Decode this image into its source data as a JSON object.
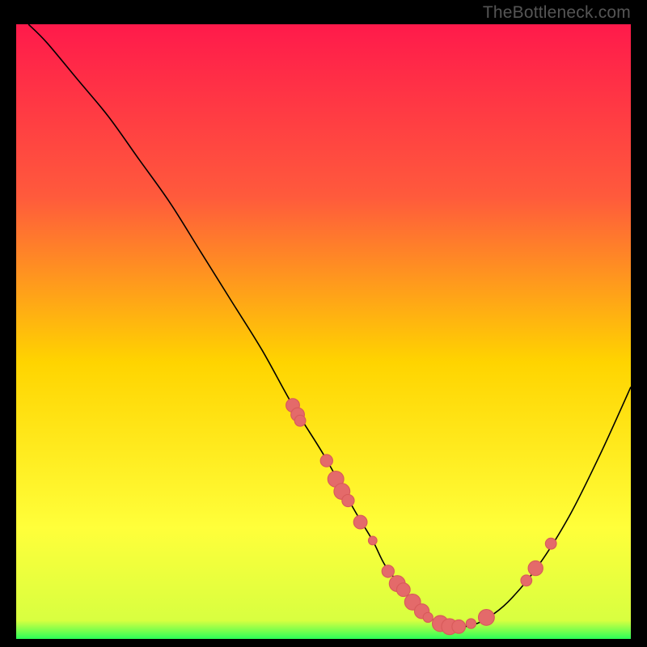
{
  "watermark": "TheBottleneck.com",
  "colors": {
    "background": "#000000",
    "gradient_top": "#ff1a4b",
    "gradient_upper": "#ff5a3c",
    "gradient_mid": "#ffd400",
    "gradient_lower": "#ffff3a",
    "gradient_bottom": "#2bff58",
    "curve": "#000000",
    "marker_fill": "#e46a6a",
    "marker_stroke": "#d85a5a"
  },
  "chart_data": {
    "type": "line",
    "title": "",
    "xlabel": "",
    "ylabel": "",
    "xlim": [
      0,
      100
    ],
    "ylim": [
      0,
      100
    ],
    "series": [
      {
        "name": "bottleneck-curve",
        "x": [
          2,
          5,
          10,
          15,
          20,
          25,
          30,
          35,
          40,
          45,
          50,
          55,
          58,
          60,
          63,
          65,
          68,
          70,
          73,
          76,
          80,
          85,
          90,
          95,
          100
        ],
        "y": [
          100,
          97,
          91,
          85,
          78,
          71,
          63,
          55,
          47,
          38,
          30,
          21,
          16,
          12,
          8,
          5,
          3,
          2,
          2,
          3,
          6,
          12,
          20,
          30,
          41
        ]
      }
    ],
    "markers": [
      {
        "x": 45.0,
        "y": 38.0,
        "r": 1.1
      },
      {
        "x": 45.8,
        "y": 36.5,
        "r": 1.1
      },
      {
        "x": 46.2,
        "y": 35.5,
        "r": 0.9
      },
      {
        "x": 50.5,
        "y": 29.0,
        "r": 1.0
      },
      {
        "x": 52.0,
        "y": 26.0,
        "r": 1.3
      },
      {
        "x": 53.0,
        "y": 24.0,
        "r": 1.3
      },
      {
        "x": 54.0,
        "y": 22.5,
        "r": 1.0
      },
      {
        "x": 56.0,
        "y": 19.0,
        "r": 1.1
      },
      {
        "x": 58.0,
        "y": 16.0,
        "r": 0.7
      },
      {
        "x": 60.5,
        "y": 11.0,
        "r": 1.0
      },
      {
        "x": 62.0,
        "y": 9.0,
        "r": 1.3
      },
      {
        "x": 63.0,
        "y": 8.0,
        "r": 1.1
      },
      {
        "x": 64.5,
        "y": 6.0,
        "r": 1.3
      },
      {
        "x": 66.0,
        "y": 4.5,
        "r": 1.2
      },
      {
        "x": 67.0,
        "y": 3.5,
        "r": 0.8
      },
      {
        "x": 69.0,
        "y": 2.5,
        "r": 1.3
      },
      {
        "x": 70.5,
        "y": 2.0,
        "r": 1.3
      },
      {
        "x": 72.0,
        "y": 2.0,
        "r": 1.1
      },
      {
        "x": 74.0,
        "y": 2.5,
        "r": 0.8
      },
      {
        "x": 76.5,
        "y": 3.5,
        "r": 1.3
      },
      {
        "x": 83.0,
        "y": 9.5,
        "r": 0.9
      },
      {
        "x": 84.5,
        "y": 11.5,
        "r": 1.2
      },
      {
        "x": 87.0,
        "y": 15.5,
        "r": 0.9
      }
    ]
  }
}
